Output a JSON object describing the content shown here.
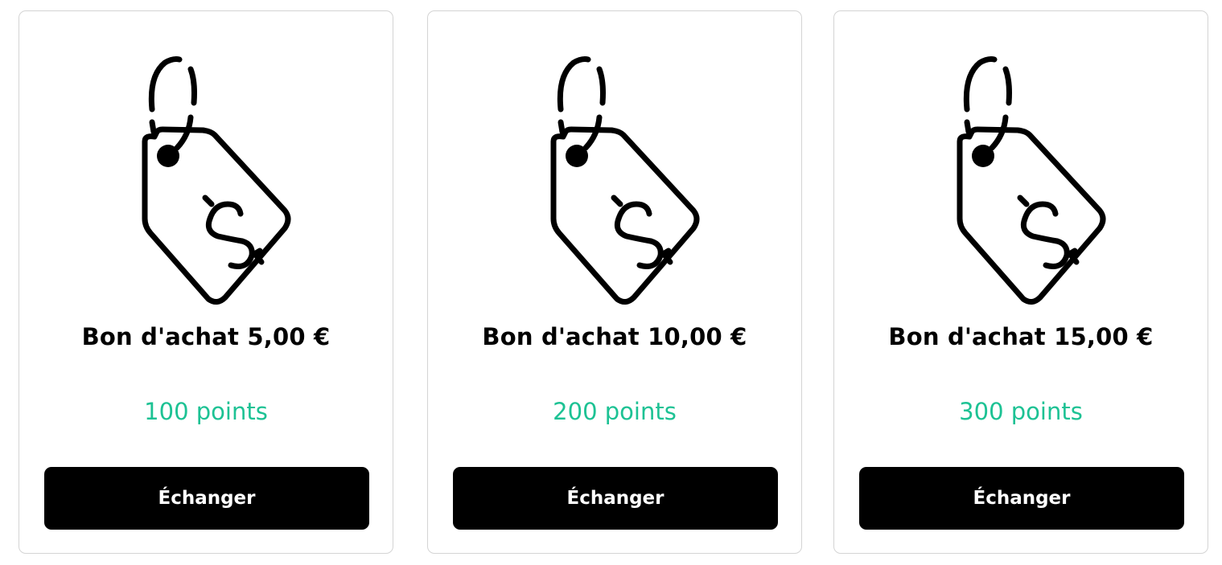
{
  "offers": [
    {
      "title": "Bon d'achat 5,00 €",
      "points": "100 points",
      "button": "Échanger",
      "icon": "price-tag-dollar-icon"
    },
    {
      "title": "Bon d'achat 10,00 €",
      "points": "200 points",
      "button": "Échanger",
      "icon": "price-tag-dollar-icon"
    },
    {
      "title": "Bon d'achat 15,00 €",
      "points": "300 points",
      "button": "Échanger",
      "icon": "price-tag-dollar-icon"
    }
  ],
  "colors": {
    "points": "#1dc294",
    "button_bg": "#000000",
    "button_text": "#ffffff",
    "card_border": "#d4d4d4"
  }
}
